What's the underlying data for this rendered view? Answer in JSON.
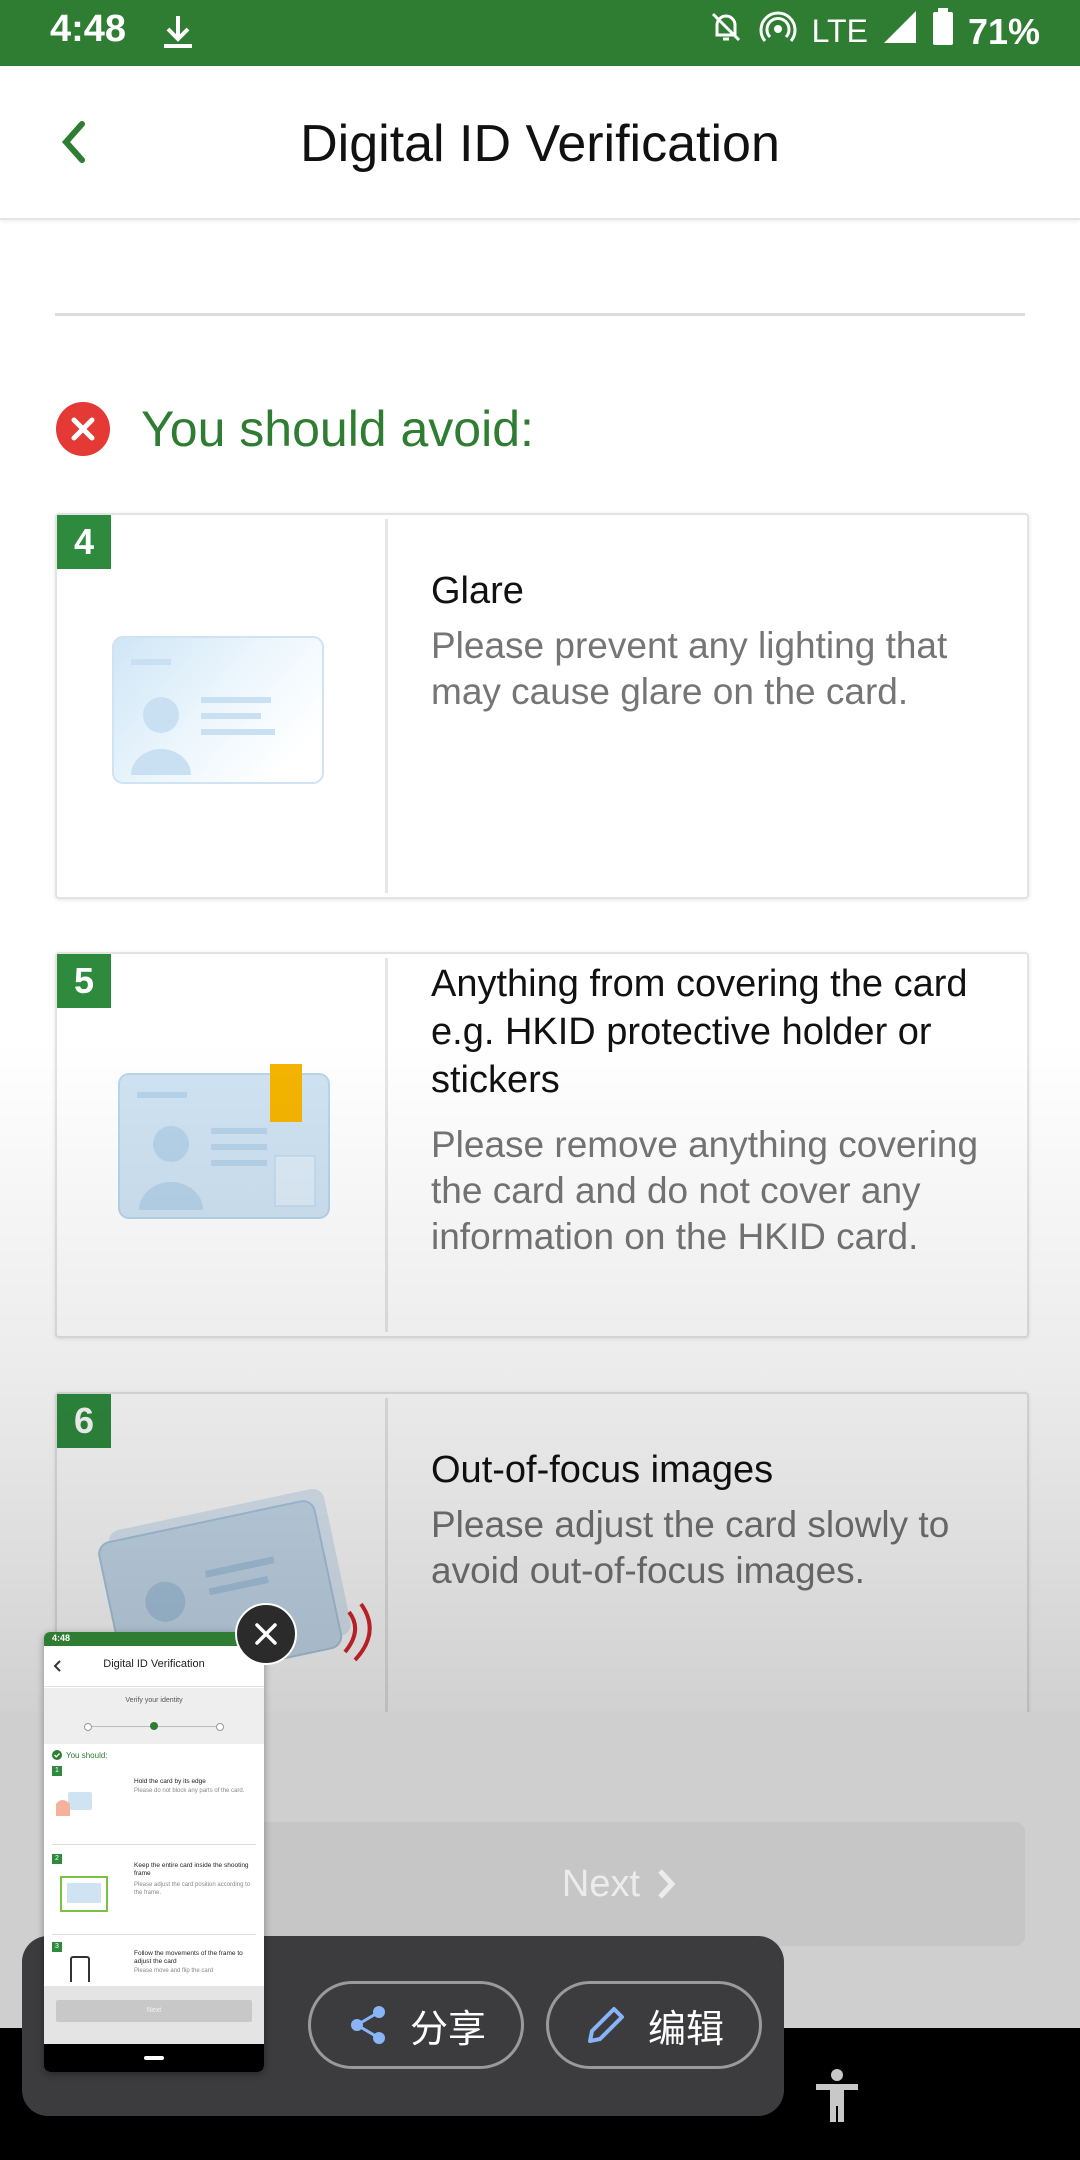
{
  "status_bar": {
    "time": "4:48",
    "network": "LTE",
    "battery": "71%"
  },
  "header": {
    "title": "Digital ID Verification"
  },
  "section": {
    "heading": "You should avoid:"
  },
  "cards": [
    {
      "number": "4",
      "title": "Glare",
      "desc": "Please prevent any lighting that may cause glare on the card."
    },
    {
      "number": "5",
      "title": "Anything from covering the card e.g. HKID protective holder or stickers",
      "desc": "Please remove anything covering the card and do not cover any information on the HKID card."
    },
    {
      "number": "6",
      "title": "Out-of-focus images",
      "desc": "Please adjust the card slowly to avoid out-of-focus images."
    }
  ],
  "next_button": {
    "label": "Next"
  },
  "share_sheet": {
    "share_label": "分享",
    "edit_label": "编辑"
  },
  "preview": {
    "time": "4:48",
    "title": "Digital ID Verification",
    "step_label": "Verify your identity",
    "heading": "You should:",
    "items": [
      {
        "number": "1",
        "title": "Hold the card by its edge",
        "desc": "Please do not block any parts of the card."
      },
      {
        "number": "2",
        "title": "Keep the entire card inside the shooting frame",
        "desc": "Please adjust the card position according to the frame."
      },
      {
        "number": "3",
        "title": "Follow the movements of the frame to adjust the card",
        "desc": "Please move and flip the card"
      }
    ],
    "next_label": "Next"
  },
  "colors": {
    "brand_green": "#2e7d32",
    "badge_green": "#2e8b3e",
    "error_red": "#e53935"
  }
}
